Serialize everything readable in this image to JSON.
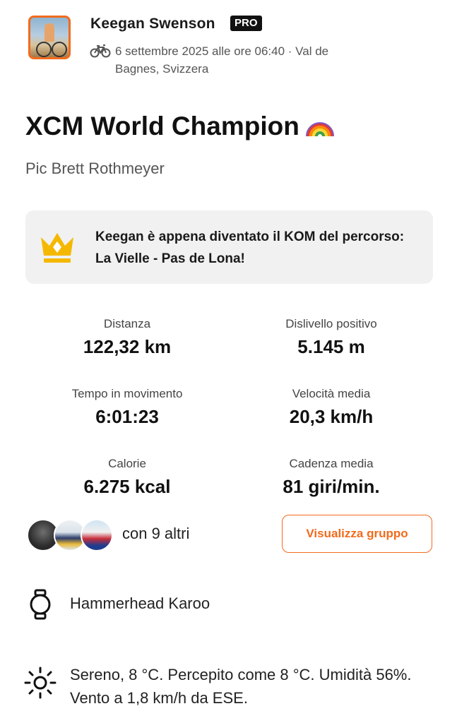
{
  "activity": {
    "athlete_name": "Keegan  Swenson",
    "badge": "PRO",
    "date_location": "6 settembre 2025 alle ore 06:40 · Val de Bagnes, Svizzera",
    "title": "XCM World Champion",
    "description": "Pic Brett Rothmeyer"
  },
  "kom": {
    "text": "Keegan  è appena diventato il KOM del percorso: La Vielle - Pas de Lona!",
    "icon": "crown-icon",
    "color": "#f5b800"
  },
  "stats": [
    {
      "label": "Distanza",
      "value": "122,32 km"
    },
    {
      "label": "Dislivello positivo",
      "value": "5.145 m"
    },
    {
      "label": "Tempo in movimento",
      "value": "6:01:23"
    },
    {
      "label": "Velocità media",
      "value": "20,3 km/h"
    },
    {
      "label": "Calorie",
      "value": "6.275 kcal"
    },
    {
      "label": "Cadenza media",
      "value": "81 giri/min."
    }
  ],
  "group": {
    "with_others": "con 9 altri",
    "button_label": "Visualizza gruppo",
    "accent": "#f26b1d"
  },
  "device": {
    "name": "Hammerhead Karoo",
    "icon": "watch-icon"
  },
  "weather": {
    "text": "Sereno, 8 °C. Percepito come 8 °C. Umidità 56%. Vento a 1,8 km/h da ESE.",
    "icon": "sun-icon"
  }
}
